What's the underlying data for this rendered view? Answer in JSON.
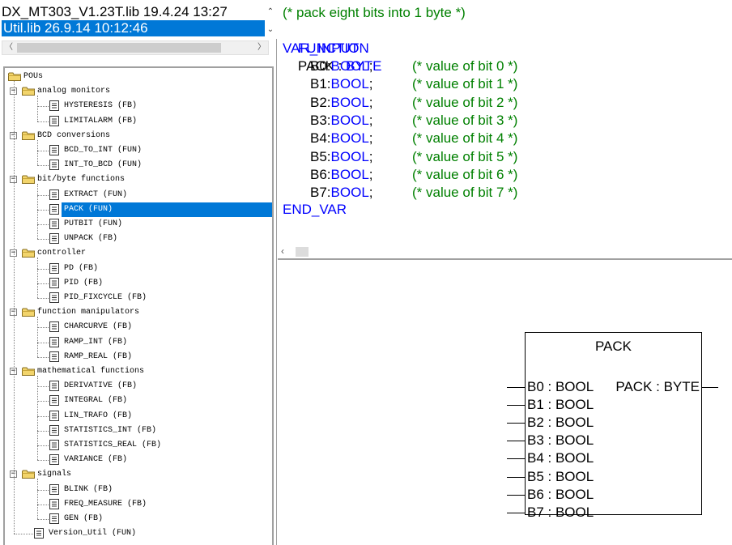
{
  "library_selector": {
    "items": [
      "DX_MT303_V1.23T.lib 19.4.24 13:27",
      "Util.lib 26.9.14 10:12:46"
    ],
    "selected_index": 1
  },
  "tree": {
    "root": "POUs",
    "groups": [
      {
        "name": "analog monitors",
        "items": [
          "HYSTERESIS (FB)",
          "LIMITALARM (FB)"
        ]
      },
      {
        "name": "BCD conversions",
        "items": [
          "BCD_TO_INT (FUN)",
          "INT_TO_BCD (FUN)"
        ]
      },
      {
        "name": "bit/byte functions",
        "items": [
          "EXTRACT (FUN)",
          "PACK (FUN)",
          "PUTBIT (FUN)",
          "UNPACK (FB)"
        ]
      },
      {
        "name": "controller",
        "items": [
          "PD (FB)",
          "PID (FB)",
          "PID_FIXCYCLE (FB)"
        ]
      },
      {
        "name": "function manipulators",
        "items": [
          "CHARCURVE (FB)",
          "RAMP_INT (FB)",
          "RAMP_REAL (FB)"
        ]
      },
      {
        "name": "mathematical functions",
        "items": [
          "DERIVATIVE (FB)",
          "INTEGRAL (FB)",
          "LIN_TRAFO (FB)",
          "STATISTICS_INT (FB)",
          "STATISTICS_REAL (FB)",
          "VARIANCE (FB)"
        ]
      },
      {
        "name": "signals",
        "items": [
          "BLINK (FB)",
          "FREQ_MEASURE (FB)",
          "GEN (FB)"
        ]
      }
    ],
    "tail_item": "Version_Util (FUN)",
    "selected_item": "PACK (FUN)"
  },
  "declaration": {
    "comment_header": "(* pack eight bits into 1 byte *)",
    "function_kw": "FUNCTION",
    "function_name": "PACK",
    "colon": " : ",
    "return_type": "BYTE",
    "var_input_kw": "VAR_INPUT",
    "vars": [
      {
        "name": "B0",
        "type": "BOOL",
        "comment": "(* value of bit 0 *)"
      },
      {
        "name": "B1",
        "type": "BOOL",
        "comment": "(* value of bit 1 *)"
      },
      {
        "name": "B2",
        "type": "BOOL",
        "comment": "(* value of bit 2 *)"
      },
      {
        "name": "B3",
        "type": "BOOL",
        "comment": "(* value of bit 3 *)"
      },
      {
        "name": "B4",
        "type": "BOOL",
        "comment": "(* value of bit 4 *)"
      },
      {
        "name": "B5",
        "type": "BOOL",
        "comment": "(* value of bit 5 *)"
      },
      {
        "name": "B6",
        "type": "BOOL",
        "comment": "(* value of bit 6 *)"
      },
      {
        "name": "B7",
        "type": "BOOL",
        "comment": "(* value of bit 7 *)"
      }
    ],
    "end_var_kw": "END_VAR"
  },
  "graphic": {
    "block_title": "PACK",
    "output_label": "PACK : BYTE",
    "inputs": [
      "B0 : BOOL",
      "B1 : BOOL",
      "B2 : BOOL",
      "B3 : BOOL",
      "B4 : BOOL",
      "B5 : BOOL",
      "B6 : BOOL",
      "B7 : BOOL"
    ]
  },
  "colors": {
    "keyword": "#0000ff",
    "comment": "#008000",
    "selection": "#0078d7"
  }
}
